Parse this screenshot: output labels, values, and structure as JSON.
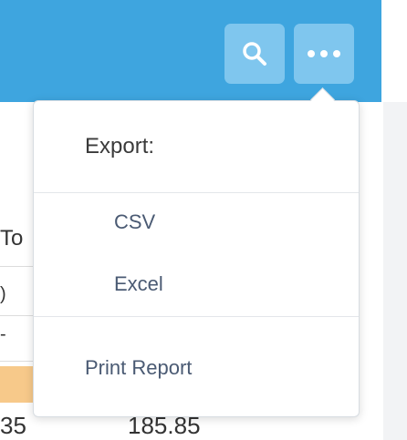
{
  "toolbar": {
    "search_icon": "search-icon",
    "more_icon": "more-horizontal-icon"
  },
  "background": {
    "column_header_fragment": "To",
    "row1_fragment": ")",
    "row2_fragment": "-",
    "bottom_left_fragment": "35",
    "bottom_value": "185.85"
  },
  "menu": {
    "header": "Export:",
    "items": [
      {
        "label": "CSV"
      },
      {
        "label": "Excel"
      }
    ],
    "print_label": "Print Report"
  },
  "colors": {
    "header_bg": "#3ea5df",
    "icon_btn_bg": "#7fc6ee",
    "menu_text": "#4a5a73",
    "highlight_row": "#f7c98a"
  }
}
